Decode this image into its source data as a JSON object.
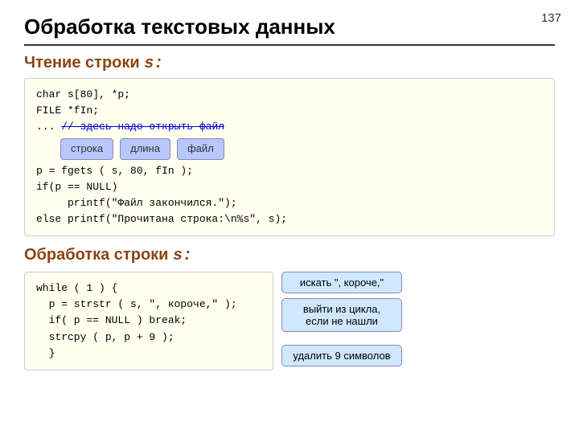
{
  "page": {
    "number": "137",
    "title": "Обработка текстовых данных",
    "section1": {
      "label": "Чтение строки ",
      "label_s": "s:",
      "code_lines": [
        "char s[80], *p;",
        "FILE *fIn;",
        "... // здесь надо открыть файл",
        "",
        "p = fgets ( s, 80, fIn );",
        "if(p == NULL)",
        "     printf(\"Файл закончился.\");",
        "else printf(\"Прочитана строка:\\n%s\", s);"
      ],
      "tooltips": [
        "строка",
        "длина",
        "файл"
      ]
    },
    "section2": {
      "label": "Обработка строки ",
      "label_s": "s:",
      "code_lines": [
        "while ( 1 ) {",
        "  p = strstr ( s, \", короче,\" );",
        "  if( p == NULL ) break;",
        "  strcpy ( p, p + 9 );",
        "  }"
      ],
      "callouts": [
        "искать \", короче,\"",
        "выйти из цикла,\nесли не нашли",
        "удалить 9 символов"
      ]
    }
  }
}
